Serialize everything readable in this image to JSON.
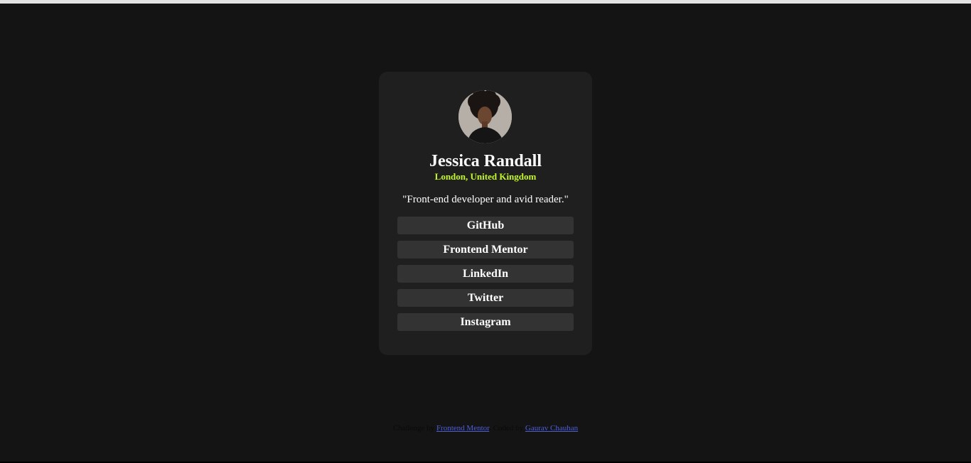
{
  "profile": {
    "name": "Jessica Randall",
    "location": "London, United Kingdom",
    "bio": "\"Front-end developer and avid reader.\""
  },
  "links": [
    {
      "label": "GitHub"
    },
    {
      "label": "Frontend Mentor"
    },
    {
      "label": "LinkedIn"
    },
    {
      "label": "Twitter"
    },
    {
      "label": "Instagram"
    }
  ],
  "footer": {
    "challenge_prefix": "Challenge by",
    "challenge_link": "Frontend Mentor",
    "coded_prefix": ". Coded by",
    "coded_link": "Gaurav Chauhan"
  },
  "colors": {
    "page_background": "#141414",
    "card_background": "#1f1f1f",
    "button_background": "#333333",
    "accent": "#c4f82a",
    "footer_link": "#4d5fd6"
  }
}
